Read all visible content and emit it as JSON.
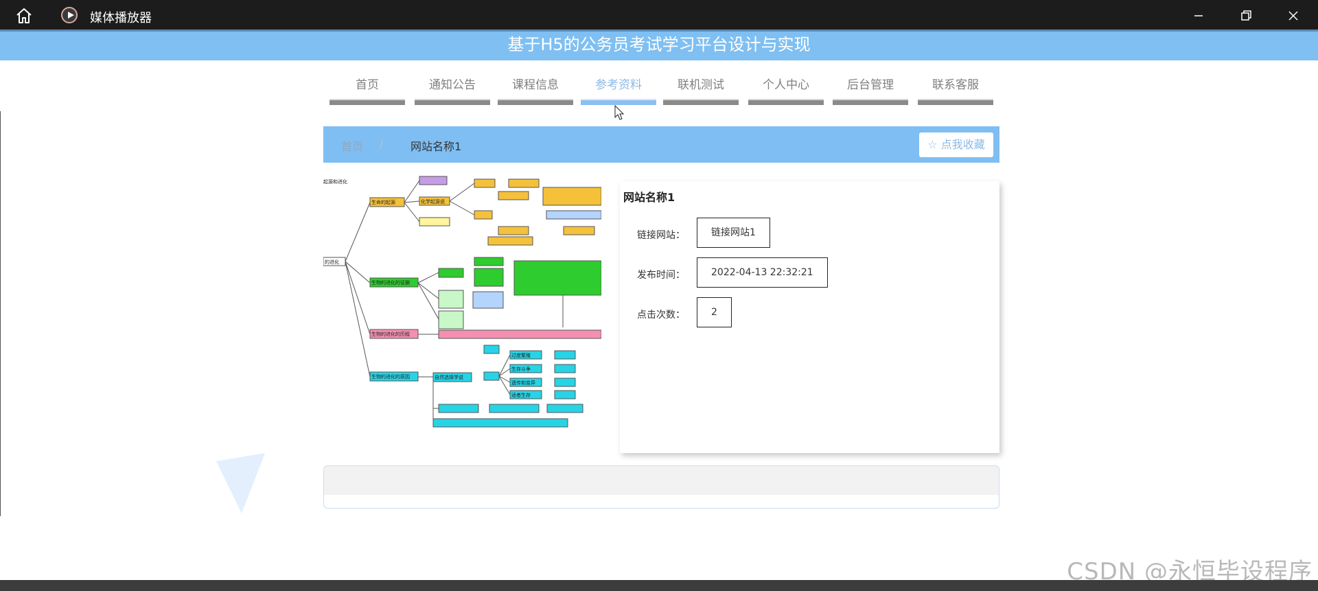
{
  "window": {
    "app_name": "媒体播放器",
    "home_icon": "home-icon",
    "controls": [
      "minimize-icon",
      "maximize-icon",
      "close-icon"
    ]
  },
  "site": {
    "title": "基于H5的公务员考试学习平台设计与实现",
    "accent_color": "#7fbef2"
  },
  "nav": {
    "items": [
      {
        "label": "首页"
      },
      {
        "label": "通知公告"
      },
      {
        "label": "课程信息"
      },
      {
        "label": "参考资料",
        "active": true
      },
      {
        "label": "联机测试"
      },
      {
        "label": "个人中心"
      },
      {
        "label": "后台管理"
      },
      {
        "label": "联系客服"
      }
    ]
  },
  "breadcrumb": {
    "home": "首页",
    "separator": "/",
    "current": "网站名称1",
    "favorite_button": "☆ 点我收藏"
  },
  "detail": {
    "title": "网站名称1",
    "fields": [
      {
        "label": "链接网站：",
        "value": "链接网站1"
      },
      {
        "label": "发布时间：",
        "value": "2022-04-13 22:32:21"
      },
      {
        "label": "点击次数：",
        "value": "2"
      }
    ]
  },
  "mindmap": {
    "root": "的进化",
    "heading": "起源和进化",
    "nodes": [
      "生命的起源",
      "化学起源说",
      "生物的进化的证据",
      "生物的进化的历程",
      "生物的进化的原因",
      "自然选择学说",
      "过度繁殖",
      "生存斗争",
      "遗传和变异",
      "适者生存"
    ]
  },
  "watermark": "CSDN @永恒毕设程序"
}
